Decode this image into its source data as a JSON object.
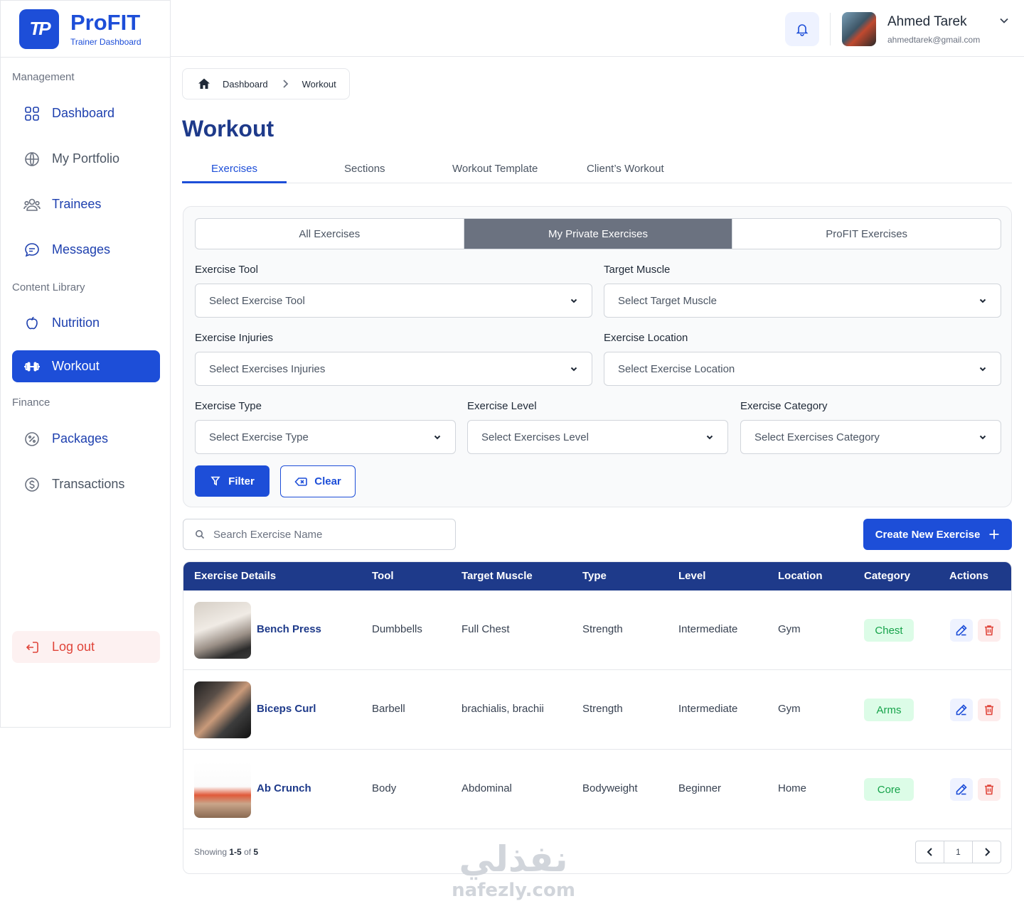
{
  "brand": {
    "logo_text": "TP",
    "name": "ProFIT",
    "subtitle": "Trainer Dashboard"
  },
  "sidebar": {
    "sections": {
      "management": "Management",
      "content": "Content Library",
      "finance": "Finance"
    },
    "items": [
      {
        "label": "Dashboard",
        "icon": "grid-icon"
      },
      {
        "label": "My Portfolio",
        "icon": "globe-icon"
      },
      {
        "label": "Trainees",
        "icon": "users-icon"
      },
      {
        "label": "Messages",
        "icon": "chat-icon"
      },
      {
        "label": "Nutrition",
        "icon": "apple-icon"
      },
      {
        "label": "Workout",
        "icon": "dumbbell-icon"
      },
      {
        "label": "Packages",
        "icon": "percent-icon"
      },
      {
        "label": "Transactions",
        "icon": "dollar-icon"
      }
    ],
    "logout": "Log out"
  },
  "header": {
    "user_name": "Ahmed Tarek",
    "user_email": "ahmedtarek@gmail.com"
  },
  "breadcrumb": {
    "home": "Dashboard",
    "current": "Workout"
  },
  "page": {
    "title": "Workout"
  },
  "tabs": [
    "Exercises",
    "Sections",
    "Workout Template",
    "Client’s Workout"
  ],
  "segments": [
    "All Exercises",
    "My Private Exercises",
    "ProFIT Exercises"
  ],
  "filters": {
    "tool": {
      "label": "Exercise Tool",
      "placeholder": "Select Exercise Tool"
    },
    "muscle": {
      "label": "Target Muscle",
      "placeholder": "Select Target Muscle"
    },
    "injuries": {
      "label": "Exercise Injuries",
      "placeholder": "Select Exercises Injuries"
    },
    "location": {
      "label": "Exercise Location",
      "placeholder": "Select Exercise Location"
    },
    "type": {
      "label": "Exercise Type",
      "placeholder": "Select Exercise Type"
    },
    "level": {
      "label": "Exercise Level",
      "placeholder": "Select Exercises Level"
    },
    "category": {
      "label": "Exercise Category",
      "placeholder": "Select Exercises Category"
    },
    "filter_btn": "Filter",
    "clear_btn": "Clear"
  },
  "search": {
    "placeholder": "Search Exercise Name"
  },
  "create_btn": "Create New Exercise",
  "table": {
    "headers": [
      "Exercise Details",
      "Tool",
      "Target Muscle",
      "Type",
      "Level",
      "Location",
      "Category",
      "Actions"
    ],
    "rows": [
      {
        "name": "Bench Press",
        "tool": "Dumbbells",
        "muscle": "Full Chest",
        "type": "Strength",
        "level": "Intermediate",
        "location": "Gym",
        "category": "Chest"
      },
      {
        "name": "Biceps Curl",
        "tool": "Barbell",
        "muscle": "brachialis, brachii",
        "type": "Strength",
        "level": "Intermediate",
        "location": "Gym",
        "category": "Arms"
      },
      {
        "name": "Ab Crunch",
        "tool": "Body",
        "muscle": "Abdominal",
        "type": "Bodyweight",
        "level": "Beginner",
        "location": "Home",
        "category": "Core"
      }
    ],
    "showing_prefix": "Showing",
    "showing_range": "1-5",
    "showing_of": "of",
    "showing_total": "5",
    "page": "1"
  },
  "watermark": {
    "arabic": "نفذلي",
    "latin": "nafezly.com"
  },
  "colors": {
    "primary": "#1d4ed8",
    "navy": "#1e3a8a",
    "danger": "#e0453a",
    "success": "#16a34a"
  }
}
